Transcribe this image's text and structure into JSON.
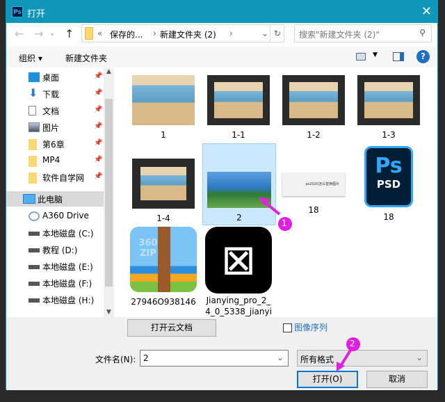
{
  "window": {
    "title": "打开",
    "app_icon": "Ps",
    "close": "✕"
  },
  "nav": {
    "back": "←",
    "forward": "→",
    "up": "↑",
    "path_overflow": "«",
    "path": [
      "保存的...",
      "新建文件夹 (2)"
    ],
    "refresh": "↻",
    "search_placeholder": "搜索\"新建文件夹 (2)\""
  },
  "toolbar": {
    "organize": "组织 ▾",
    "new_folder": "新建文件夹",
    "help": "?"
  },
  "sidebar": {
    "quick": [
      {
        "label": "桌面",
        "icon": "desktop-icon"
      },
      {
        "label": "下载",
        "icon": "download-icon"
      },
      {
        "label": "文档",
        "icon": "document-icon"
      },
      {
        "label": "图片",
        "icon": "pictures-icon"
      },
      {
        "label": "第6章",
        "icon": "folder-icon"
      },
      {
        "label": "MP4",
        "icon": "folder-icon"
      },
      {
        "label": "软件自学网",
        "icon": "folder-icon"
      }
    ],
    "this_pc": "此电脑",
    "drives": [
      {
        "label": "A360 Drive"
      },
      {
        "label": "本地磁盘 (C:)"
      },
      {
        "label": "教程 (D:)"
      },
      {
        "label": "本地磁盘 (E:)"
      },
      {
        "label": "本地磁盘 (F:)"
      },
      {
        "label": "本地磁盘 (H:)"
      }
    ]
  },
  "files": [
    {
      "name": "1",
      "type": "image"
    },
    {
      "name": "1-1",
      "type": "screenshot"
    },
    {
      "name": "1-2",
      "type": "screenshot"
    },
    {
      "name": "1-3",
      "type": "screenshot"
    },
    {
      "name": "1-4",
      "type": "screenshot"
    },
    {
      "name": "2",
      "type": "image",
      "selected": true
    },
    {
      "name": "18",
      "type": "banner",
      "banner_text": "ps2020怎么替换图片"
    },
    {
      "name": "18",
      "type": "psd",
      "icon_text": "Ps",
      "sub": "PSD"
    },
    {
      "name": "27946O938146",
      "type": "zip",
      "icon_text": "360 ZIP"
    },
    {
      "name": "Jianying_pro_2_4_0_5338_jianyi",
      "line1": "Jianying_pro_2_",
      "line2": "4_0_5338_jianyi",
      "type": "capcut"
    }
  ],
  "bottom": {
    "cloud_button": "打开云文档",
    "image_sequence": "图像序列",
    "image_sequence_checked": false,
    "filename_label": "文件名(N):",
    "filename_value": "2",
    "format_value": "所有格式",
    "open_button": "打开(O)",
    "cancel_button": "取消"
  },
  "annotations": {
    "marker1": "1",
    "marker2": "2",
    "color": "#e020e0"
  },
  "colors": {
    "titlebar": "#0e97b9",
    "selection": "#cce8ff"
  }
}
